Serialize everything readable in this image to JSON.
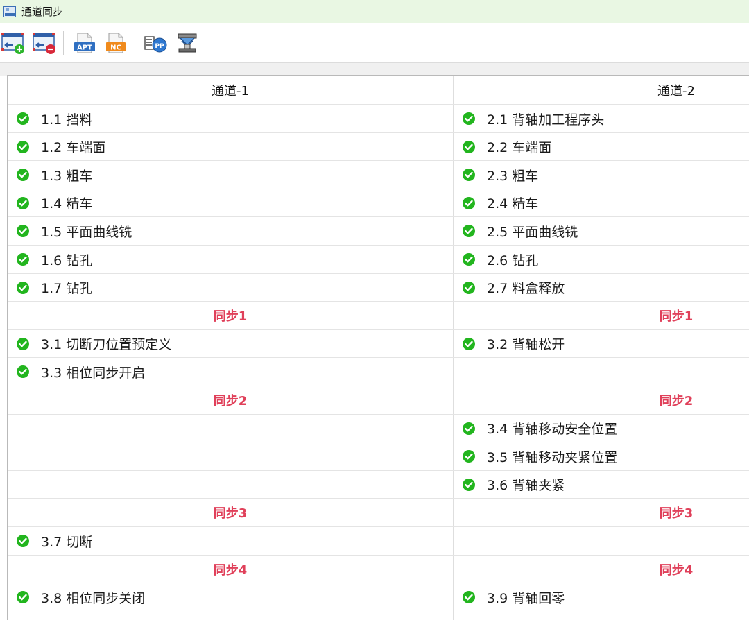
{
  "window": {
    "title": "通道同步"
  },
  "toolbar": {
    "buttons": [
      {
        "name": "add-channel-button",
        "icon": "add-channel-icon"
      },
      {
        "name": "remove-channel-button",
        "icon": "remove-channel-icon"
      },
      {
        "name": "apt-button",
        "label": "APT",
        "icon": "apt-file-icon"
      },
      {
        "name": "nc-button",
        "label": "NC",
        "icon": "nc-file-icon"
      },
      {
        "name": "post-process-button",
        "label": "PP",
        "icon": "post-process-icon"
      },
      {
        "name": "machine-simulation-button",
        "icon": "machine-icon"
      }
    ]
  },
  "colors": {
    "check": "#22b51e",
    "sync_text": "#e0405a",
    "title_bg": "#e9f7e3"
  },
  "table": {
    "columns": [
      "通道-1",
      "通道-2"
    ],
    "rows": [
      {
        "type": "op",
        "cells": [
          "1.1 挡料",
          "2.1 背轴加工程序头"
        ]
      },
      {
        "type": "op",
        "cells": [
          "1.2 车端面",
          "2.2 车端面"
        ]
      },
      {
        "type": "op",
        "cells": [
          "1.3 粗车",
          "2.3 粗车"
        ]
      },
      {
        "type": "op",
        "cells": [
          "1.4 精车",
          "2.4 精车"
        ]
      },
      {
        "type": "op",
        "cells": [
          "1.5 平面曲线铣",
          "2.5 平面曲线铣"
        ]
      },
      {
        "type": "op",
        "cells": [
          "1.6 钻孔",
          "2.6 钻孔"
        ]
      },
      {
        "type": "op",
        "cells": [
          "1.7 钻孔",
          "2.7 料盒释放"
        ]
      },
      {
        "type": "sync",
        "cells": [
          "同步1",
          "同步1"
        ]
      },
      {
        "type": "op",
        "cells": [
          "3.1 切断刀位置预定义",
          "3.2 背轴松开"
        ]
      },
      {
        "type": "op",
        "cells": [
          "3.3 相位同步开启",
          ""
        ]
      },
      {
        "type": "sync",
        "cells": [
          "同步2",
          "同步2"
        ]
      },
      {
        "type": "op",
        "cells": [
          "",
          "3.4 背轴移动安全位置"
        ]
      },
      {
        "type": "op",
        "cells": [
          "",
          "3.5 背轴移动夹紧位置"
        ]
      },
      {
        "type": "op",
        "cells": [
          "",
          "3.6 背轴夹紧"
        ]
      },
      {
        "type": "sync",
        "cells": [
          "同步3",
          "同步3"
        ]
      },
      {
        "type": "op",
        "cells": [
          "3.7 切断",
          ""
        ]
      },
      {
        "type": "sync",
        "cells": [
          "同步4",
          "同步4"
        ]
      },
      {
        "type": "op",
        "cells": [
          "3.8 相位同步关闭",
          "3.9 背轴回零"
        ]
      }
    ]
  }
}
